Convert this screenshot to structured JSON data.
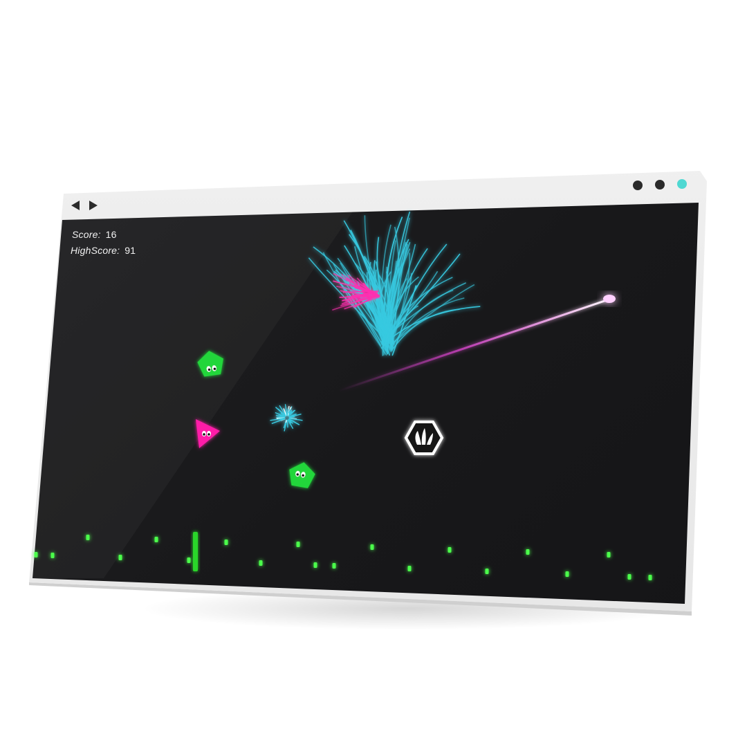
{
  "hud": {
    "score_label": "Score:",
    "score_value": "16",
    "highscore_label": "HighScore:",
    "highscore_value": "91"
  },
  "window_controls": {
    "dot_colors": [
      "#2a2a2a",
      "#2a2a2a",
      "#4fd8d2"
    ]
  },
  "colors": {
    "enemy_green": "#22d63a",
    "enemy_pink": "#ff1fa8",
    "burst_cyan": "#37c9e0",
    "burst_pink": "#ff2fb0",
    "laser": "#ff4df0",
    "ground_pip": "#4cff4c"
  },
  "icons": {
    "player": "hexagon-sprout-icon",
    "back": "arrow-left-icon",
    "forward": "arrow-right-icon"
  }
}
